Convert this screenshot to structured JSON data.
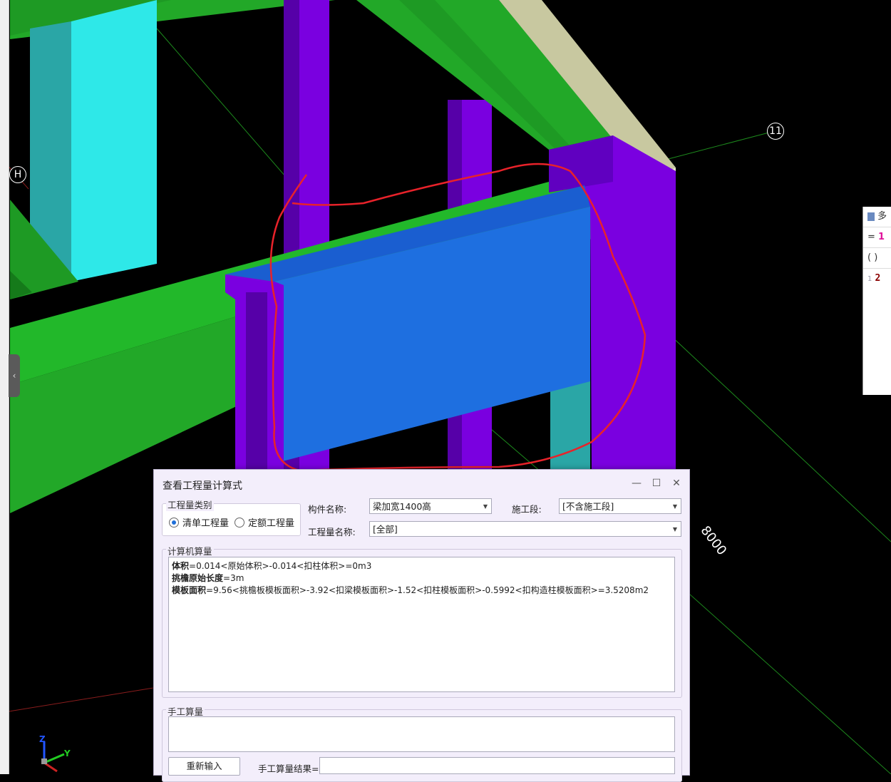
{
  "viewport": {
    "axis_labels": [
      "H",
      "11"
    ],
    "dimension_label": "8000",
    "collapse_icon": "chevron-left-icon",
    "gizmo_axes": [
      "Z",
      "Y"
    ]
  },
  "side_panel": {
    "title_fragment": "多",
    "eq_symbol": "=",
    "eq_value_fragment": "1",
    "paren_symbol": "( )",
    "line_number": "1",
    "line_value_fragment": "2"
  },
  "dialog": {
    "title": "查看工程量计算式",
    "window_buttons": [
      "minimize-icon",
      "maximize-icon",
      "close-icon"
    ],
    "category_group": {
      "label": "工程量类别",
      "options": [
        "清单工程量",
        "定额工程量"
      ],
      "selected_index": 0
    },
    "component_name_label": "构件名称:",
    "component_name_value": "梁加宽1400高",
    "construction_stage_label": "施工段:",
    "construction_stage_value": "[不含施工段]",
    "quantity_name_label": "工程量名称:",
    "quantity_name_value": "[全部]",
    "computer_calc": {
      "label": "计算机算量",
      "lines": [
        {
          "name": "体积",
          "expr": "=0.014<原始体积>-0.014<扣柱体积>=0m3"
        },
        {
          "name": "挑檐原始长度",
          "expr": "=3m"
        },
        {
          "name": "模板面积",
          "expr": "=9.56<挑檐板模板面积>-3.92<扣梁模板面积>-1.52<扣柱模板面积>-0.5992<扣构造柱模板面积>=3.5208m2"
        }
      ]
    },
    "manual_calc": {
      "label": "手工算量",
      "reenter_button": "重新输入",
      "result_label": "手工算量结果="
    }
  },
  "colors": {
    "beam_green": "#22a828",
    "column_purple": "#7a00e0",
    "column_cyan": "#2ee8e8",
    "slab_blue": "#1e6fe0",
    "annotation_red": "#e8222a"
  }
}
